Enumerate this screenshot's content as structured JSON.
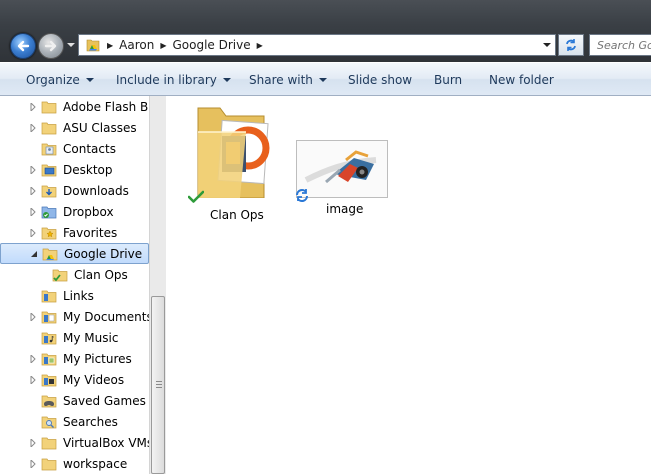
{
  "address": {
    "crumbs": [
      "Aaron",
      "Google Drive"
    ]
  },
  "search": {
    "placeholder": "Search Google Drive"
  },
  "toolbar": {
    "organize": "Organize",
    "include_in_library": "Include in library",
    "share_with": "Share with",
    "slide_show": "Slide show",
    "burn": "Burn",
    "new_folder": "New folder"
  },
  "nav": {
    "items": [
      {
        "label": "Adobe Flash Buil",
        "icon": "folder-icon"
      },
      {
        "label": "ASU Classes",
        "icon": "folder-icon"
      },
      {
        "label": "Contacts",
        "icon": "contacts-icon"
      },
      {
        "label": "Desktop",
        "icon": "desktop-icon"
      },
      {
        "label": "Downloads",
        "icon": "downloads-icon"
      },
      {
        "label": "Dropbox",
        "icon": "dropbox-folder-icon"
      },
      {
        "label": "Favorites",
        "icon": "favorites-icon"
      },
      {
        "label": "Google Drive",
        "icon": "google-drive-folder-icon"
      },
      {
        "label": "Clan Ops",
        "icon": "synced-folder-icon"
      },
      {
        "label": "Links",
        "icon": "links-icon"
      },
      {
        "label": "My Documents",
        "icon": "documents-icon"
      },
      {
        "label": "My Music",
        "icon": "music-icon"
      },
      {
        "label": "My Pictures",
        "icon": "pictures-icon"
      },
      {
        "label": "My Videos",
        "icon": "videos-icon"
      },
      {
        "label": "Saved Games",
        "icon": "saved-games-icon"
      },
      {
        "label": "Searches",
        "icon": "searches-icon"
      },
      {
        "label": "VirtualBox VMs",
        "icon": "folder-icon"
      },
      {
        "label": "workspace",
        "icon": "folder-icon"
      }
    ]
  },
  "files": [
    {
      "label": "Clan Ops",
      "type": "folder",
      "status": "synced"
    },
    {
      "label": "image",
      "type": "image",
      "status": "syncing"
    }
  ],
  "colors": {
    "accent": "#3c7fd2",
    "selection": "#c1dbfc",
    "folder": "#f2d27a",
    "sync_green": "#2e9b3a",
    "sync_blue": "#2a78d6"
  }
}
